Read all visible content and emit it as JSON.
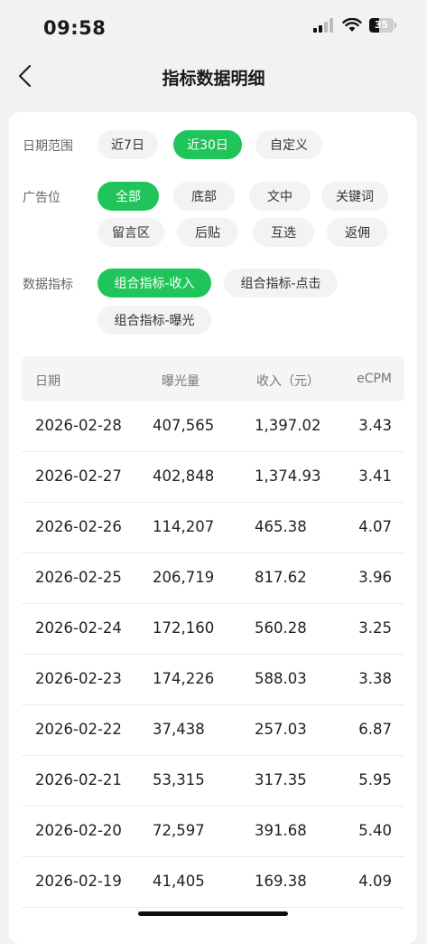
{
  "status": {
    "time": "09:58",
    "battery": "35"
  },
  "nav": {
    "title": "指标数据明细"
  },
  "filters": {
    "date_range": {
      "label": "日期范围",
      "options": [
        "近7日",
        "近30日",
        "自定义"
      ],
      "selected": "近30日"
    },
    "ad_position": {
      "label": "广告位",
      "options": [
        "全部",
        "底部",
        "文中",
        "关键词",
        "留言区",
        "后贴",
        "互选",
        "返佣"
      ],
      "selected": "全部"
    },
    "metrics": {
      "label": "数据指标",
      "options": [
        "组合指标-收入",
        "组合指标-点击",
        "组合指标-曝光"
      ],
      "selected": "组合指标-收入"
    }
  },
  "table": {
    "headers": [
      "日期",
      "曝光量",
      "收入（元）",
      "eCPM"
    ],
    "rows": [
      [
        "2026-02-28",
        "407,565",
        "1,397.02",
        "3.43"
      ],
      [
        "2026-02-27",
        "402,848",
        "1,374.93",
        "3.41"
      ],
      [
        "2026-02-26",
        "114,207",
        "465.38",
        "4.07"
      ],
      [
        "2026-02-25",
        "206,719",
        "817.62",
        "3.96"
      ],
      [
        "2026-02-24",
        "172,160",
        "560.28",
        "3.25"
      ],
      [
        "2026-02-23",
        "174,226",
        "588.03",
        "3.38"
      ],
      [
        "2026-02-22",
        "37,438",
        "257.03",
        "6.87"
      ],
      [
        "2026-02-21",
        "53,315",
        "317.35",
        "5.95"
      ],
      [
        "2026-02-20",
        "72,597",
        "391.68",
        "5.40"
      ],
      [
        "2026-02-19",
        "41,405",
        "169.38",
        "4.09"
      ]
    ]
  },
  "colors": {
    "accent": "#1fc45a",
    "chip_bg": "#f3f3f3",
    "page_bg": "#f2f2f2"
  }
}
